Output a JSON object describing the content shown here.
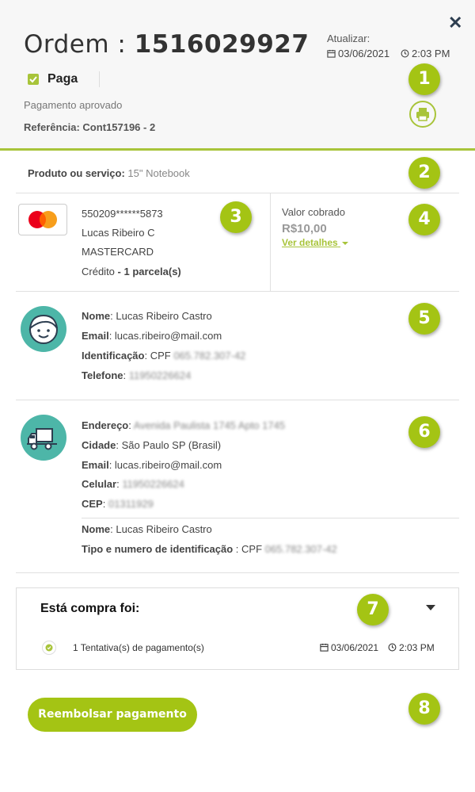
{
  "header": {
    "order_prefix": "Ordem : ",
    "order_number": "1516029927",
    "update_label": "Atualizar:",
    "update_date": "03/06/2021",
    "update_time": "2:03 PM",
    "status": "Paga",
    "status_detail": "Pagamento aprovado",
    "reference": "Referência: Cont157196 - 2"
  },
  "product": {
    "label": "Produto ou serviço:",
    "value": "15\" Notebook"
  },
  "payment_card": {
    "number": "550209******5873",
    "holder": "Lucas Ribeiro C",
    "brand": "MASTERCARD",
    "type": "Crédito",
    "installments": "- 1 parcela(s)"
  },
  "charge": {
    "label": "Valor cobrado",
    "amount": "R$10,00",
    "details_link": "Ver detalhes"
  },
  "buyer": {
    "name_label": "Nome",
    "name": "Lucas Ribeiro Castro",
    "email_label": "Email",
    "email": "lucas.ribeiro@mail.com",
    "id_label": "Identificação",
    "id_type": "CPF",
    "id_value": "065.782.307-42",
    "phone_label": "Telefone",
    "phone": "11950226624"
  },
  "shipping": {
    "address_label": "Endereço",
    "address": "Avenida Paulista 1745 Apto 1745",
    "city_label": "Cidade",
    "city": "São Paulo SP (Brasil)",
    "email_label": "Email",
    "email": "lucas.ribeiro@mail.com",
    "cell_label": "Celular",
    "cell": "11950226624",
    "cep_label": "CEP",
    "cep": "01311929",
    "recipient_label": "Nome",
    "recipient": "Lucas Ribeiro Castro",
    "recipient_id_label": "Tipo e numero de identificação",
    "recipient_id_type": "CPF",
    "recipient_id_value": "065.782.307-42"
  },
  "history": {
    "title": "Está compra foi:",
    "attempts": "1 Tentativa(s) de pagamento(s)",
    "date": "03/06/2021",
    "time": "2:03 PM"
  },
  "actions": {
    "refund_label": "Reembolsar pagamento"
  },
  "badges": [
    "1",
    "2",
    "3",
    "4",
    "5",
    "6",
    "7",
    "8"
  ],
  "colors": {
    "accent": "#a8c43a",
    "badge": "#a4c414",
    "avatar": "#4db6a8"
  },
  "icons": [
    "close-icon",
    "calendar-icon",
    "clock-icon",
    "check-icon",
    "printer-icon",
    "mastercard-logo",
    "user-avatar-icon",
    "delivery-truck-icon",
    "caret-down-icon"
  ]
}
